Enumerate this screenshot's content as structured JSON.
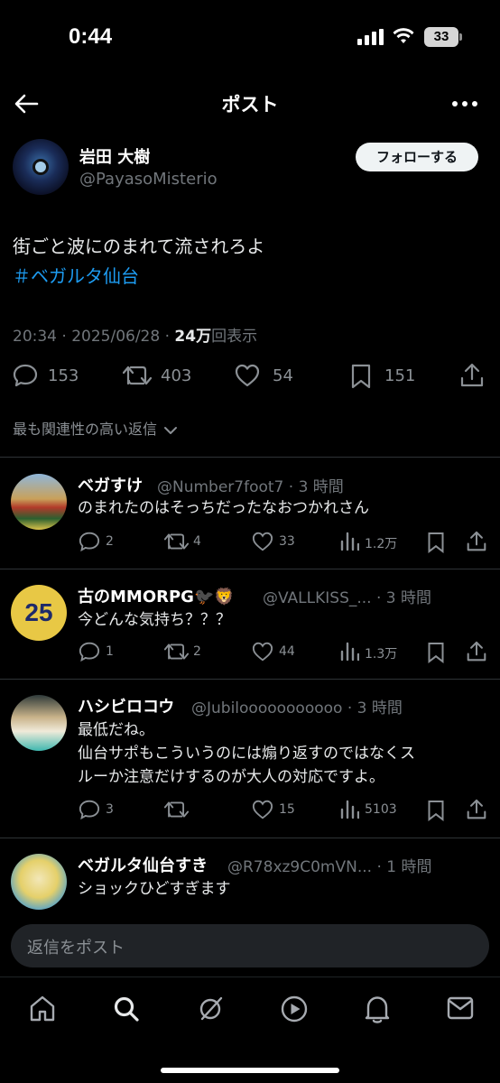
{
  "status_bar": {
    "time": "0:44",
    "battery": "33"
  },
  "nav": {
    "title": "ポスト"
  },
  "post": {
    "author_name": "岩田 大樹",
    "author_handle": "@PayasoMisterio",
    "follow_label": "フォローする",
    "text": "街ごと波にのまれて流されろよ",
    "hashtag": "＃ベガルタ仙台",
    "time": "20:34 · 2025/06/28 · ",
    "views": "24万",
    "views_label": "回表示",
    "stats": {
      "replies": "153",
      "reposts": "403",
      "likes": "54",
      "bookmarks": "151"
    }
  },
  "sort": {
    "label": "最も関連性の高い返信"
  },
  "replies": [
    {
      "name": "ベガすけ",
      "handle": "@Number7foot7 · 3 時間",
      "text": "のまれたのはそっちだったなおつかれさん",
      "replies": "2",
      "reposts": "4",
      "likes": "33",
      "views": "1.2万"
    },
    {
      "name": "古のMMORPG🐦‍⬛🦁",
      "handle": "@VALLKISS_... · 3 時間",
      "text": "今どんな気持ち？？？",
      "replies": "1",
      "reposts": "2",
      "likes": "44",
      "views": "1.3万"
    },
    {
      "name": "ハシビロコウ",
      "handle": "@Jubilooooooooooo · 3 時間",
      "text": "最低だね。",
      "text2": "仙台サポもこういうのには煽り返すのではなくス",
      "text3": "ルーか注意だけするのが大人の対応ですよ。",
      "replies": "3",
      "reposts": "",
      "likes": "15",
      "views": "5103"
    },
    {
      "name": "ベガルタ仙台すき",
      "handle": "@R78xz9C0mVN... · 1 時間",
      "text": "ショックひどすぎます"
    }
  ],
  "compose": {
    "placeholder": "返信をポスト"
  },
  "tabs": [
    "home",
    "search",
    "grok",
    "video",
    "notifications",
    "messages"
  ],
  "colors": {
    "background": "#000000",
    "accent": "#1d9bf0",
    "muted": "#71767b"
  }
}
